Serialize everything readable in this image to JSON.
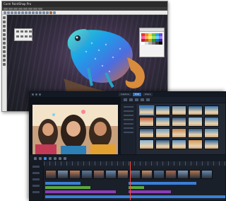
{
  "photo_editor": {
    "title": "Corel PaintShop Pro",
    "swatches": [
      "#e23b2e",
      "#f08a24",
      "#f6d13a",
      "#6cc04a",
      "#2fa6de",
      "#6b4bd1",
      "#ff5fa2",
      "#ffb15c",
      "#fff06a",
      "#9ee06f",
      "#66d2ff",
      "#9b7bff",
      "#b81f3b",
      "#c25b12",
      "#c9a11c",
      "#2f8e3a",
      "#1a6ea8",
      "#41289a",
      "#ffffff",
      "#d9d9d9",
      "#a6a6a6",
      "#737373",
      "#3c3c3c",
      "#000000"
    ],
    "accent": "#2fa6de"
  },
  "video_editor": {
    "tabs": [
      "Capture",
      "Edit",
      "Share"
    ],
    "active_tab": "Edit",
    "accent": "#2f6fbe",
    "thumbnails": [
      "#2b6aa8",
      "#3d7eb8",
      "#6b8fa8",
      "#2c5f91",
      "#3c78b0",
      "#b85c3d",
      "#4d86b6",
      "#2e4f7a",
      "#7aa6c8",
      "#3a74a6",
      "#1f4f83",
      "#6a9cc4",
      "#c2824d",
      "#2b5b8e",
      "#4c87b8",
      "#8bb3d1",
      "#345e8c",
      "#5a8fbf",
      "#d39a5a",
      "#2f6599"
    ],
    "timeline_clips": [
      "#9c6b4f",
      "#7b8fa8",
      "#c07d57",
      "#5d7a9c",
      "#a3705a",
      "#6c8cb1",
      "#b98462",
      "#5a7291",
      "#c99167",
      "#4f6d8f",
      "#a86a52",
      "#7d9ab8",
      "#b3774f",
      "#6788ac"
    ],
    "tracks": [
      {
        "color": "#3a7fd6"
      },
      {
        "color": "#5aa83a"
      },
      {
        "color": "#8b3db6"
      },
      {
        "color": "#3a7fd6"
      }
    ]
  }
}
